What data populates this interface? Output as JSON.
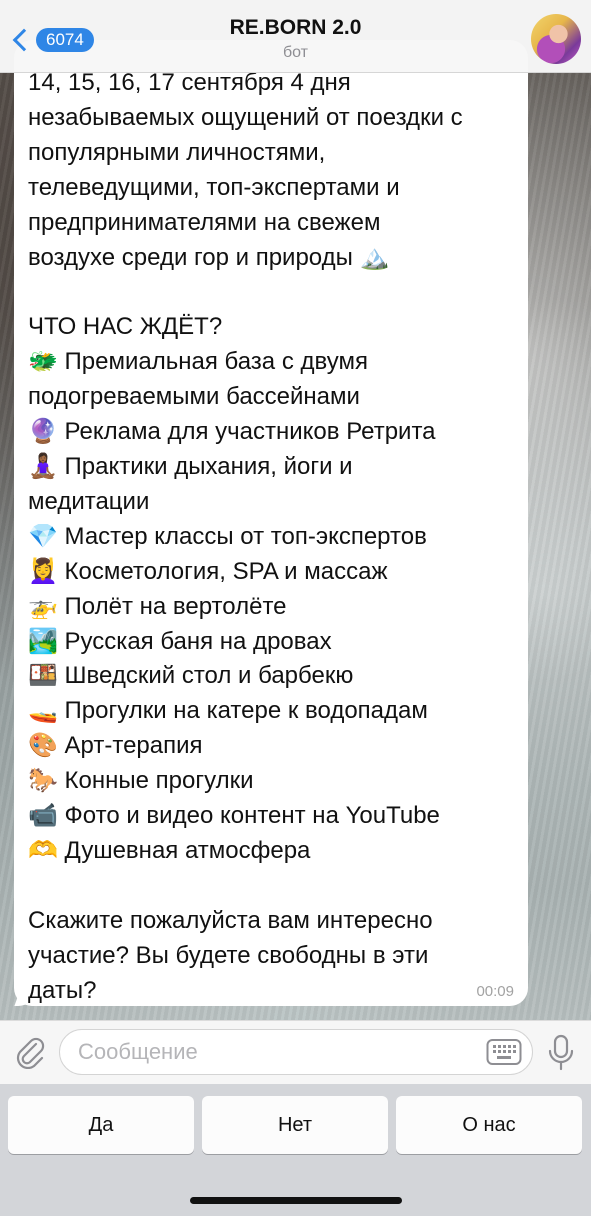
{
  "header": {
    "back_count": "6074",
    "title": "RE.BORN 2.0",
    "subtitle": "бот"
  },
  "message": {
    "text": "14, 15, 16, 17 сентября 4 дня\nнезабываемых ощущений от поездки с\nпопулярными личностями,\nтелеведущими, топ-экспертами и\nпредпринимателями на свежем\nвоздухе среди гор и природы 🏔️\n\nЧТО НАС ЖДЁТ?\n🐲 Премиальная база с двумя\nподогреваемыми бассейнами\n🔮 Реклама для участников Ретрита\n🧘🏾‍♀️ Практики дыхания, йоги и\nмедитации\n💎 Мастер классы от топ-экспертов\n💆‍♀️ Косметология, SPA и массаж\n🚁 Полёт на вертолёте\n🏞️ Русская баня на дровах\n🍱 Шведский стол и барбекю\n🚤 Прогулки на катере к водопадам\n🎨 Арт-терапия\n🐎 Конные прогулки\n📹 Фото и видео контент на YouTube\n🫶 Душевная атмосфера\n\nСкажите пожалуйста вам интересно\nучастие? Вы будете свободны в эти\nдаты?",
    "time": "00:09"
  },
  "input": {
    "placeholder": "Сообщение",
    "value": ""
  },
  "reply_buttons": [
    "Да",
    "Нет",
    "О нас"
  ],
  "colors": {
    "accent": "#2f86e6",
    "header_bg": "#f7f7f7",
    "keyboard_bg": "#d3d5d9"
  },
  "icons": {
    "back": "chevron-left-icon",
    "attach": "paperclip-icon",
    "keyboard": "keyboard-icon",
    "mic": "microphone-icon"
  }
}
